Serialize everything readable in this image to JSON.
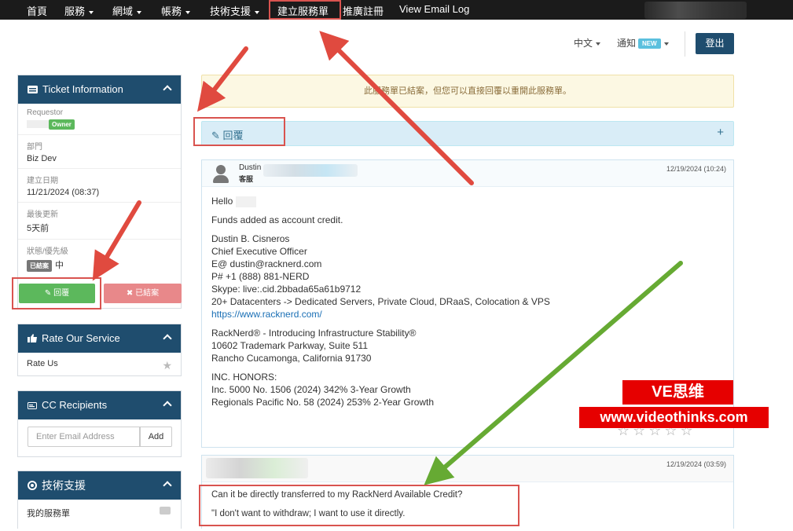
{
  "nav": {
    "items": [
      {
        "label": "首頁",
        "caret": false
      },
      {
        "label": "服務",
        "caret": true
      },
      {
        "label": "網域",
        "caret": true
      },
      {
        "label": "帳務",
        "caret": true
      },
      {
        "label": "技術支援",
        "caret": true
      },
      {
        "label": "建立服務單",
        "caret": false
      },
      {
        "label": "推廣註冊",
        "caret": false
      },
      {
        "label": "View Email Log",
        "caret": false
      }
    ]
  },
  "header": {
    "language": "中文",
    "notifications": "通知",
    "new_badge": "NEW",
    "logout": "登出"
  },
  "ticket_info": {
    "title": "Ticket Information",
    "requestor_label": "Requestor",
    "owner_badge": "Owner",
    "department_label": "部門",
    "department": "Biz Dev",
    "created_label": "建立日期",
    "created": "11/21/2024 (08:37)",
    "updated_label": "最後更新",
    "updated": "5天前",
    "status_label": "狀態/優先級",
    "status_badge": "已結案",
    "priority": "中",
    "reply_button": "回覆",
    "closed_button": "已結案"
  },
  "rate": {
    "title": "Rate Our Service",
    "item": "Rate Us"
  },
  "cc": {
    "title": "CC Recipients",
    "placeholder": "Enter Email Address",
    "add": "Add"
  },
  "support": {
    "title": "技術支援",
    "item": "我的服務單"
  },
  "main": {
    "closed_alert": "此服務單已結案，但您可以直接回覆以重開此服務單。",
    "reply_label": "回覆",
    "reply_plus": "+"
  },
  "message1": {
    "name": "Dustin",
    "role": "客服",
    "date": "12/19/2024 (10:24)",
    "greeting": "Hello",
    "line1": "Funds added as account credit.",
    "sig_name": "Dustin B. Cisneros",
    "sig_title": "Chief Executive Officer",
    "sig_email": "E@ dustin@racknerd.com",
    "sig_phone": "P# +1 (888) 881-NERD",
    "sig_skype": "Skype: live:.cid.2bbada65a61b9712",
    "sig_dc": "20+ Datacenters -> Dedicated Servers, Private Cloud, DRaaS, Colocation & VPS",
    "sig_url": "https://www.racknerd.com/",
    "company": "RackNerd® - Introducing Infrastructure Stability®",
    "address1": "10602 Trademark Parkway, Suite 511",
    "address2": "Rancho Cucamonga, California 91730",
    "honors_title": "INC. HONORS:",
    "honor1": "Inc. 5000 No. 1506 (2024) 342% 3-Year Growth",
    "honor2": "Regionals Pacific No. 58 (2024) 253% 2-Year Growth",
    "stars": "☆☆☆☆☆"
  },
  "message2": {
    "date": "12/19/2024 (03:59)",
    "line1": "Can it be directly transferred to my RackNerd Available Credit?",
    "line2": "\"I don't want to withdraw; I want to use it directly."
  },
  "watermark": {
    "line1": "VE思维",
    "line2": "www.videothinks.com"
  },
  "colors": {
    "nav_bg": "#1b1b1b",
    "panel_head": "#1f4d6e",
    "reply_green": "#5cb85c",
    "closed_red": "#e8888a",
    "annotation_red": "#d9534f",
    "annotation_green": "#66aa33",
    "watermark_red": "#e60000"
  }
}
